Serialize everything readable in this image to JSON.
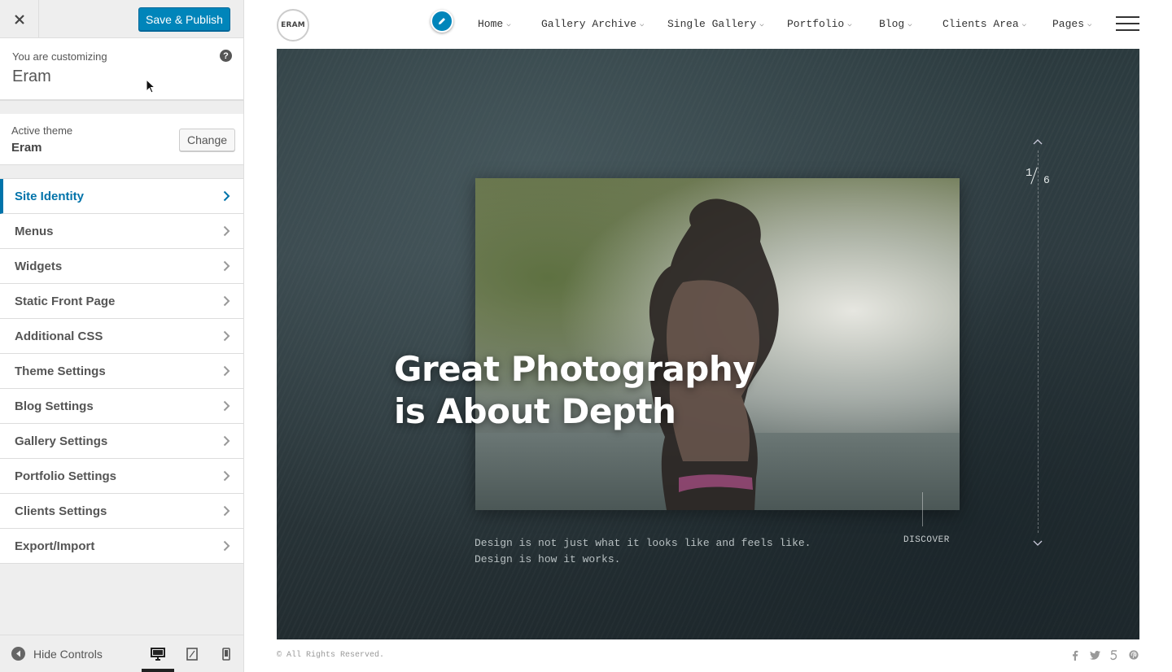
{
  "toolbar": {
    "save_label": "Save & Publish",
    "close_icon": "close-icon"
  },
  "customizing": {
    "label": "You are customizing",
    "site": "Eram",
    "help": "?"
  },
  "theme": {
    "label": "Active theme",
    "name": "Eram",
    "change_label": "Change"
  },
  "sections": [
    {
      "label": "Site Identity",
      "active": true
    },
    {
      "label": "Menus"
    },
    {
      "label": "Widgets"
    },
    {
      "label": "Static Front Page"
    },
    {
      "label": "Additional CSS"
    },
    {
      "label": "Theme Settings"
    },
    {
      "label": "Blog Settings"
    },
    {
      "label": "Gallery Settings"
    },
    {
      "label": "Portfolio Settings"
    },
    {
      "label": "Clients Settings"
    },
    {
      "label": "Export/Import"
    }
  ],
  "footer": {
    "hide_controls": "Hide Controls",
    "devices": [
      "desktop",
      "tablet",
      "mobile"
    ],
    "active_device": "desktop"
  },
  "preview": {
    "logo": "ERAM",
    "nav": [
      "Home",
      "Gallery Archive",
      "Single Gallery",
      "Portfolio",
      "Blog",
      "Clients Area",
      "Pages"
    ],
    "headline_1": "Great Photography",
    "headline_2": "is About Depth",
    "tagline_1": "Design is not just what it looks like and feels like.",
    "tagline_2": "Design is how it works.",
    "discover": "DISCOVER",
    "slide_current": "1",
    "slide_total": "6",
    "copyright": "© All Rights Reserved.",
    "social": [
      "facebook-icon",
      "twitter-icon",
      "500px-icon",
      "pinterest-icon"
    ]
  },
  "colors": {
    "accent": "#0085ba",
    "active_section": "#0073aa"
  }
}
